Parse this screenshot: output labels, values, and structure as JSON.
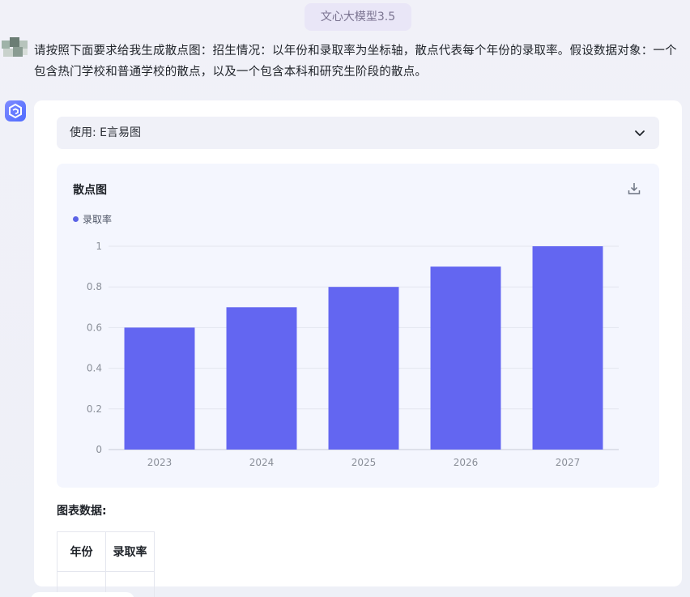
{
  "header": {
    "model_name": "文心大模型3.5"
  },
  "conversation": {
    "user_prompt": "请按照下面要求给我生成散点图：招生情况：以年份和录取率为坐标轴，散点代表每个年份的录取率。假设数据对象：一个包含热门学校和普通学校的散点，以及一个包含本科和研究生阶段的散点。"
  },
  "response": {
    "tool_label": "使用: E言易图",
    "chart_title": "散点图",
    "legend_label": "录取率",
    "table_heading": "图表数据:",
    "table_headers": [
      "年份",
      "录取率"
    ]
  },
  "icons": {
    "expand": "chevron-down-icon",
    "download": "download-icon",
    "bot": "bot-logo-icon",
    "user": "user-avatar-icon"
  },
  "colors": {
    "bar": "#6366f1",
    "accent": "#5b63e6",
    "grid": "#e3e6ef",
    "tick_text": "#8a8f99"
  },
  "chart_data": {
    "type": "bar",
    "title": "散点图",
    "categories": [
      "2023",
      "2024",
      "2025",
      "2026",
      "2027"
    ],
    "series": [
      {
        "name": "录取率",
        "values": [
          0.6,
          0.7,
          0.8,
          0.9,
          1.0
        ]
      }
    ],
    "y_ticks": [
      "0",
      "0.2",
      "0.4",
      "0.6",
      "0.8",
      "1"
    ],
    "ylim": [
      0,
      1
    ],
    "grid": true,
    "legend_position": "top-left"
  }
}
